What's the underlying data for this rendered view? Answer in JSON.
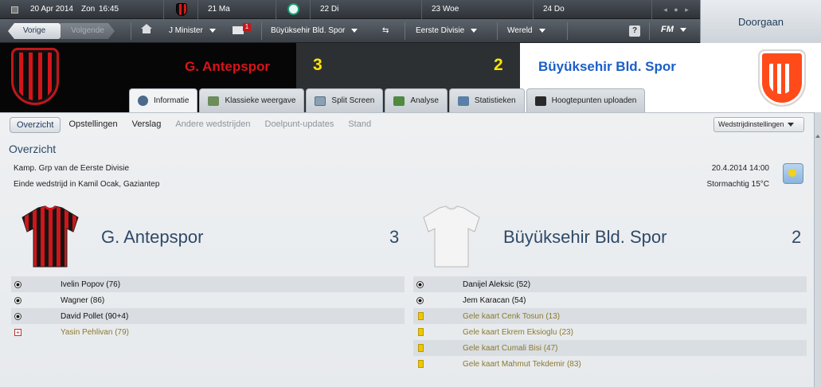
{
  "calendar": {
    "today": "20 Apr 2014",
    "today_day": "Zon",
    "time": "16:45",
    "days": [
      {
        "label": "21 Ma"
      },
      {
        "label": "22 Di"
      },
      {
        "label": "23 Woe"
      },
      {
        "label": "24 Do"
      }
    ]
  },
  "continue_label": "Doorgaan",
  "nav": {
    "back": "Vorige",
    "forward": "Volgende",
    "manager": "J Minister",
    "inbox_count": "1",
    "club": "Büyüksehir Bld. Spor",
    "league": "Eerste Divisie",
    "world": "Wereld",
    "help": "?",
    "fm": "FM"
  },
  "scoreboard": {
    "home": "G. Antepspor",
    "home_score": "3",
    "away_score": "2",
    "away": "Büyüksehir Bld. Spor"
  },
  "tabs": [
    {
      "label": "Informatie",
      "icon": "info-icon"
    },
    {
      "label": "Klassieke weergave",
      "icon": "pitch-icon"
    },
    {
      "label": "Split Screen",
      "icon": "split-screen-icon"
    },
    {
      "label": "Analyse",
      "icon": "analysis-icon"
    },
    {
      "label": "Statistieken",
      "icon": "stats-icon"
    },
    {
      "label": "Hoogtepunten uploaden",
      "icon": "camera-icon"
    }
  ],
  "subtabs": [
    {
      "label": "Overzicht"
    },
    {
      "label": "Opstellingen"
    },
    {
      "label": "Verslag"
    },
    {
      "label": "Andere wedstrijden"
    },
    {
      "label": "Doelpunt-updates"
    },
    {
      "label": "Stand"
    }
  ],
  "settings_label": "Wedstrijdinstellingen",
  "section_title": "Overzicht",
  "match_info": {
    "competition": "Kamp. Grp van de Eerste Divisie",
    "venue": "Einde wedstrijd in Kamil Ocak, Gaziantep",
    "datetime": "20.4.2014 14:00",
    "weather": "Stormachtig 15°C"
  },
  "home": {
    "name": "G. Antepspor",
    "score": "3",
    "events": [
      {
        "type": "goal",
        "text": "Ivelin Popov (76)"
      },
      {
        "type": "goal",
        "text": "Wagner (86)"
      },
      {
        "type": "goal",
        "text": "David Pollet (90+4)"
      },
      {
        "type": "sub",
        "text": "Yasin Pehlivan (79)"
      }
    ]
  },
  "away": {
    "name": "Büyüksehir Bld. Spor",
    "score": "2",
    "events": [
      {
        "type": "goal",
        "text": "Danijel Aleksic (52)"
      },
      {
        "type": "goal",
        "text": "Jem Karacan (54)"
      },
      {
        "type": "yellow",
        "text": "Gele kaart Cenk Tosun (13)"
      },
      {
        "type": "yellow",
        "text": "Gele kaart Ekrem Eksioglu (23)"
      },
      {
        "type": "yellow",
        "text": "Gele kaart Cumali Bisi (47)"
      },
      {
        "type": "yellow",
        "text": "Gele kaart Mahmut Tekdemir (83)"
      }
    ]
  },
  "colors": {
    "home_red": "#d8141a",
    "score_yellow": "#ffe600",
    "away_blue": "#1a5fc8",
    "heading": "#2e4a68"
  }
}
